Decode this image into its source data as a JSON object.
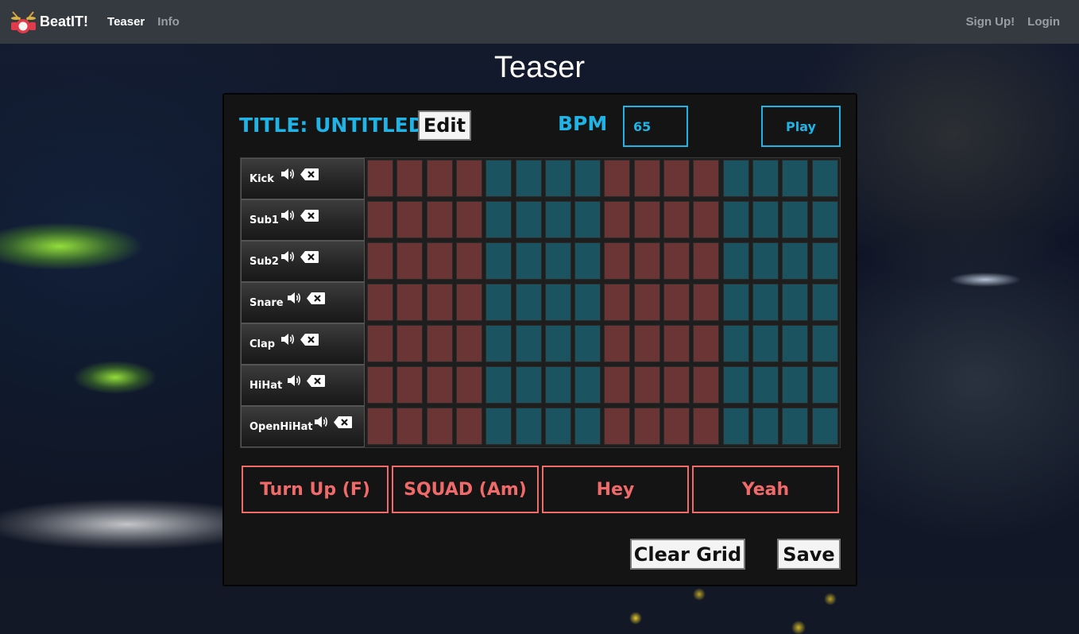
{
  "navbar": {
    "brand": "BeatIT!",
    "brand_icon": "drum-kit-icon",
    "links_left": [
      {
        "label": "Teaser",
        "active": true
      },
      {
        "label": "Info",
        "active": false
      }
    ],
    "links_right": [
      {
        "label": "Sign Up!"
      },
      {
        "label": "Login"
      }
    ]
  },
  "page": {
    "title": "Teaser"
  },
  "editor": {
    "title_label": "TITLE: UNTITLED",
    "edit_label": "Edit",
    "bpm_label": "BPM",
    "bpm_value": "65",
    "play_label": "Play",
    "clear_label": "Clear Grid",
    "save_label": "Save"
  },
  "tracks": [
    {
      "name": "Kick"
    },
    {
      "name": "Sub1"
    },
    {
      "name": "Sub2"
    },
    {
      "name": "Snare"
    },
    {
      "name": "Clap"
    },
    {
      "name": "HiHat"
    },
    {
      "name": "OpenHiHat"
    }
  ],
  "steps_per_track": 16,
  "step_colors": {
    "group_a": "#6b3535",
    "group_b": "#1b5460"
  },
  "step_groups": [
    "a",
    "a",
    "a",
    "a",
    "b",
    "b",
    "b",
    "b",
    "a",
    "a",
    "a",
    "a",
    "b",
    "b",
    "b",
    "b"
  ],
  "samples": [
    {
      "label": "Turn Up (F)"
    },
    {
      "label": "SQUAD (Am)"
    },
    {
      "label": "Hey"
    },
    {
      "label": "Yeah"
    }
  ],
  "colors": {
    "accent_blue": "#1fb3e6",
    "accent_red": "#f06a6a",
    "navbar_bg": "#343a40"
  }
}
